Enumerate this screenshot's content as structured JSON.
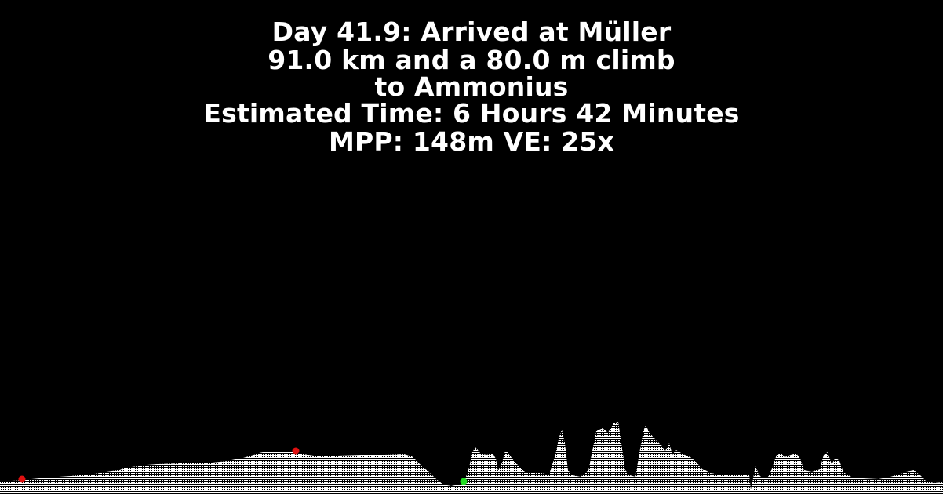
{
  "hud": {
    "line1": "Day 41.9: Arrived at Müller",
    "line2": "91.0 km and a 80.0 m climb",
    "line3": "to Ammonius",
    "line4": "Estimated Time: 6 Hours 42 Minutes",
    "line5": "MPP: 148m VE: 25x"
  },
  "colors": {
    "background": "#000000",
    "text": "#ffffff",
    "terrain_fill": "#ffffff",
    "terrain_hatch": "#000000",
    "marker_red": "#e01010",
    "marker_green": "#22dd22"
  },
  "markers": [
    {
      "name": "waypoint-red-1",
      "color": "red"
    },
    {
      "name": "waypoint-red-2",
      "color": "red"
    },
    {
      "name": "current-position-green",
      "color": "green"
    }
  ]
}
